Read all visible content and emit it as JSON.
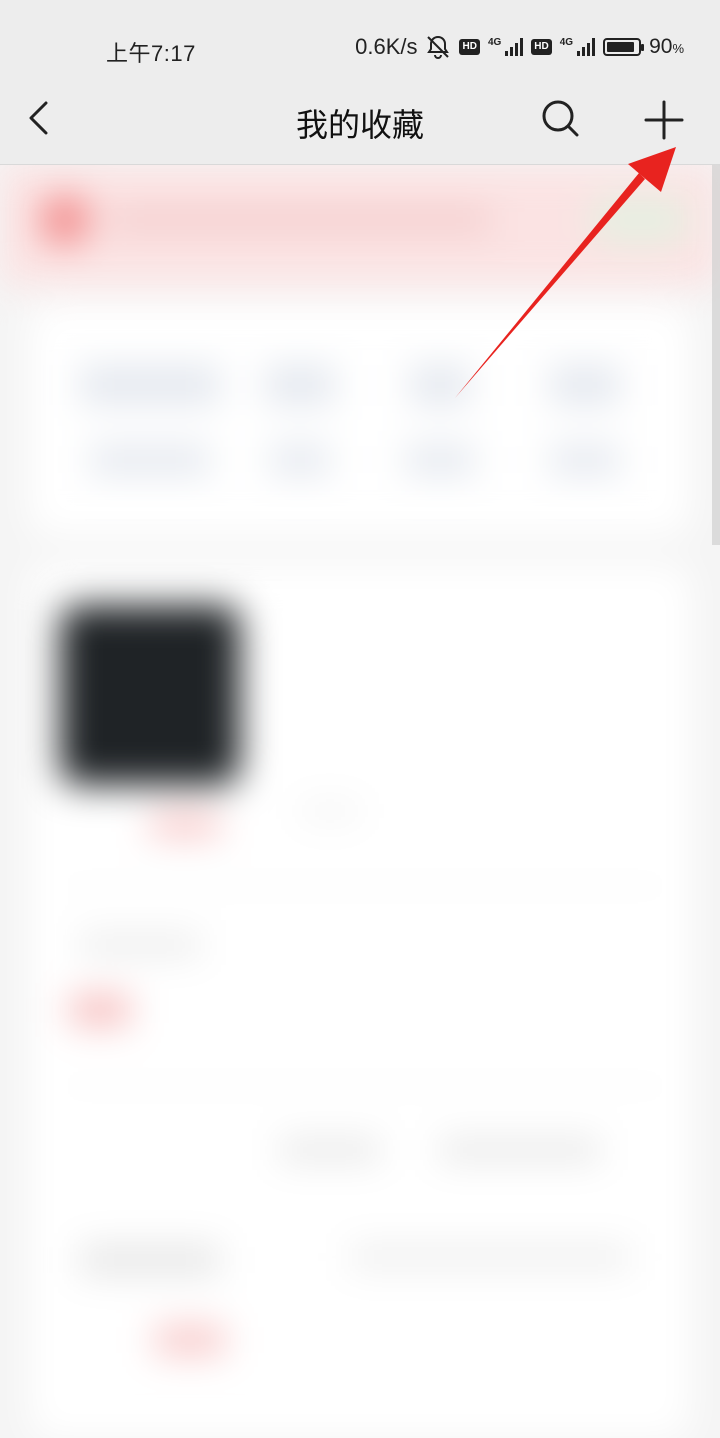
{
  "status_bar": {
    "time": "上午7:17",
    "net_speed": "0.6K/s",
    "hd_badge_1": "HD",
    "signal_label_1": "4G",
    "hd_badge_2": "HD",
    "signal_label_2": "4G",
    "battery_percent": "90",
    "battery_percent_sign": "%",
    "battery_level": 0.9
  },
  "nav": {
    "title": "我的收藏",
    "back_icon": "chevron-left-icon",
    "search_icon": "search-icon",
    "add_icon": "plus-icon"
  },
  "content": {
    "blurred": true
  },
  "annotation": {
    "arrow_color": "#e8231f"
  }
}
